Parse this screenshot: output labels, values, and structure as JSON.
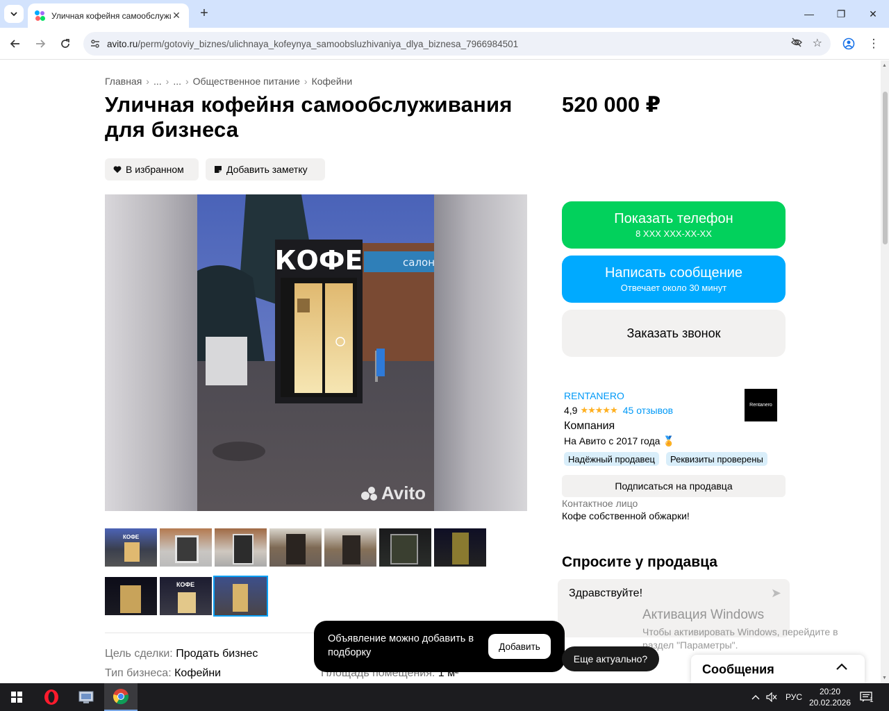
{
  "browser": {
    "tab_title": "Уличная кофейня самообслуживания для бизнеса",
    "url_host": "avito.ru",
    "url_path": "/perm/gotoviy_biznes/ulichnaya_kofeynya_samoobsluzhivaniya_dlya_biznesa_7966984501"
  },
  "breadcrumb": [
    "Главная",
    "...",
    "...",
    "Общественное питание",
    "Кофейни"
  ],
  "listing": {
    "title": "Уличная кофейня самообслуживания для бизнеса",
    "price": "520 000 ₽",
    "favorite_label": "В избранном",
    "note_label": "Добавить заметку",
    "photo_sign": "КОФЕ",
    "photo_sign_side": "салон",
    "watermark": "Avito",
    "thumbnail_sign": "КОФЕ"
  },
  "actions": {
    "phone_label": "Показать телефон",
    "phone_mask": "8 XXX XXX-XX-XX",
    "message_label": "Написать сообщение",
    "message_sub": "Отвечает около 30 минут",
    "call_label": "Заказать звонок"
  },
  "seller": {
    "name": "RENTANERO",
    "rating": "4,9",
    "stars": 5,
    "reviews": "45 отзывов",
    "type": "Компания",
    "since": "На Авито с 2017 года",
    "badges": [
      "Надёжный продавец",
      "Реквизиты проверены"
    ],
    "logo_text": "Rentanero",
    "subscribe_label": "Подписаться на продавца",
    "contact_label": "Контактное лицо",
    "contact_value": "Кофе собственной обжарки!"
  },
  "ask": {
    "title": "Спросите у продавца",
    "message": "Здравствуйте!",
    "still_actual": "Еще актуально?"
  },
  "toast": {
    "text": "Объявление можно добавить в подборку",
    "button": "Добавить"
  },
  "params": {
    "goal_label": "Цель сделки:",
    "goal_value": "Продать бизнес",
    "type_label": "Тип бизнеса:",
    "type_value": "Кофейни",
    "area_label": "Площадь помещения:",
    "area_value": "1 м²"
  },
  "activation": {
    "title": "Активация Windows",
    "text": "Чтобы активировать Windows, перейдите в раздел \"Параметры\"."
  },
  "messages_panel": {
    "title": "Сообщения"
  },
  "taskbar": {
    "lang": "РУС",
    "time": "20:20",
    "date": "20.02.2026",
    "notif_count": "1"
  },
  "colors": {
    "green": "#02d15c",
    "blue": "#00aaff",
    "link": "#0099f7"
  }
}
